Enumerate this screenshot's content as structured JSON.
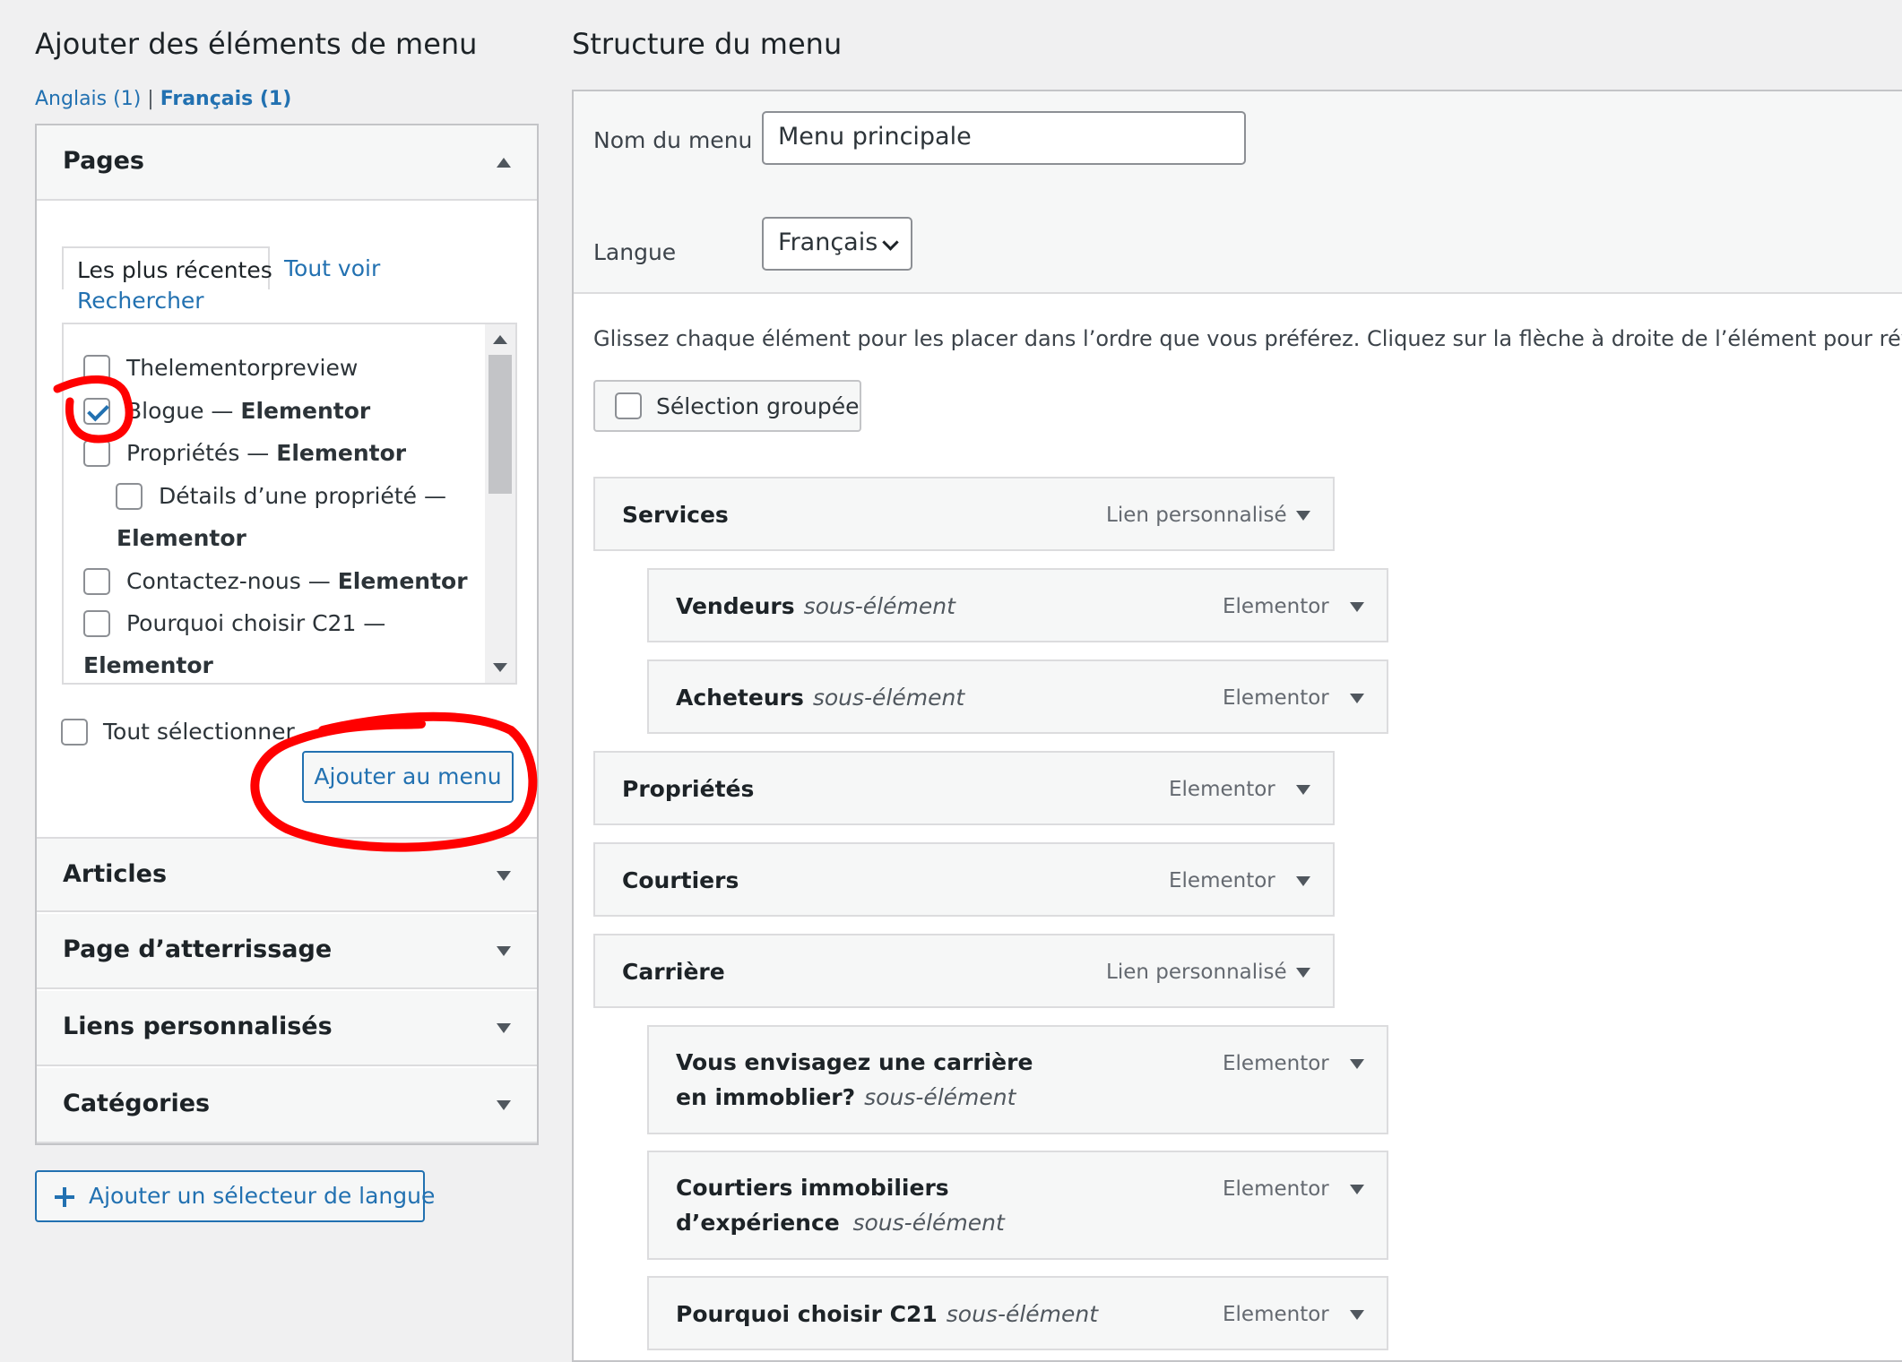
{
  "left": {
    "heading": "Ajouter des éléments de menu",
    "lang_links": {
      "en": "Anglais (1)",
      "separator": "|",
      "fr": "Français (1)"
    },
    "pages": {
      "title": "Pages",
      "tabs": {
        "recent": "Les plus récentes",
        "all": "Tout voir",
        "search": "Rechercher"
      },
      "items": [
        {
          "label": "Thelementorpreview",
          "suffix": "",
          "checked": false
        },
        {
          "label": "Blogue — ",
          "suffix": "Elementor",
          "checked": true
        },
        {
          "label": "Propriétés — ",
          "suffix": "Elementor",
          "checked": false
        },
        {
          "label": "Détails d’une propriété —",
          "suffix": "Elementor",
          "checked": false
        },
        {
          "label": "Contactez-nous — ",
          "suffix": "Elementor",
          "checked": false
        },
        {
          "label": "Pourquoi choisir C21 —",
          "suffix": "Elementor",
          "checked": false
        }
      ],
      "select_all": "Tout sélectionner",
      "add_button": "Ajouter au menu"
    },
    "sections": [
      "Articles",
      "Page d’atterrissage",
      "Liens personnalisés",
      "Catégories"
    ],
    "lang_switcher_button": "Ajouter un sélecteur de langue"
  },
  "right": {
    "heading": "Structure du menu",
    "menu_name_label": "Nom du menu",
    "menu_name_value": "Menu principale",
    "language_label": "Langue",
    "language_value": "Français",
    "help_text": "Glissez chaque élément pour les placer dans l’ordre que vous préférez. Cliquez sur la flèche à droite de l’élément pour révéler d’",
    "bulk_select": "Sélection groupée",
    "sub_label": "sous-élément",
    "menu_items": [
      {
        "title": "Services",
        "type": "Lien personnalisé",
        "sub": false
      },
      {
        "title": "Vendeurs",
        "type": "Elementor",
        "sub": true
      },
      {
        "title": "Acheteurs",
        "type": "Elementor",
        "sub": true
      },
      {
        "title": "Propriétés",
        "type": "Elementor",
        "sub": false
      },
      {
        "title": "Courtiers",
        "type": "Elementor",
        "sub": false
      },
      {
        "title": "Carrière",
        "type": "Lien personnalisé",
        "sub": false
      },
      {
        "title": "Vous envisagez une carrière en immoblier?",
        "type": "Elementor",
        "sub": true
      },
      {
        "title": "Courtiers immobiliers d’expérience",
        "type": "Elementor",
        "sub": true
      },
      {
        "title": "Pourquoi choisir C21",
        "type": "Elementor",
        "sub": true
      }
    ]
  },
  "colors": {
    "link": "#2271b1",
    "annotation": "#ff0000",
    "background": "#f0f0f1"
  }
}
